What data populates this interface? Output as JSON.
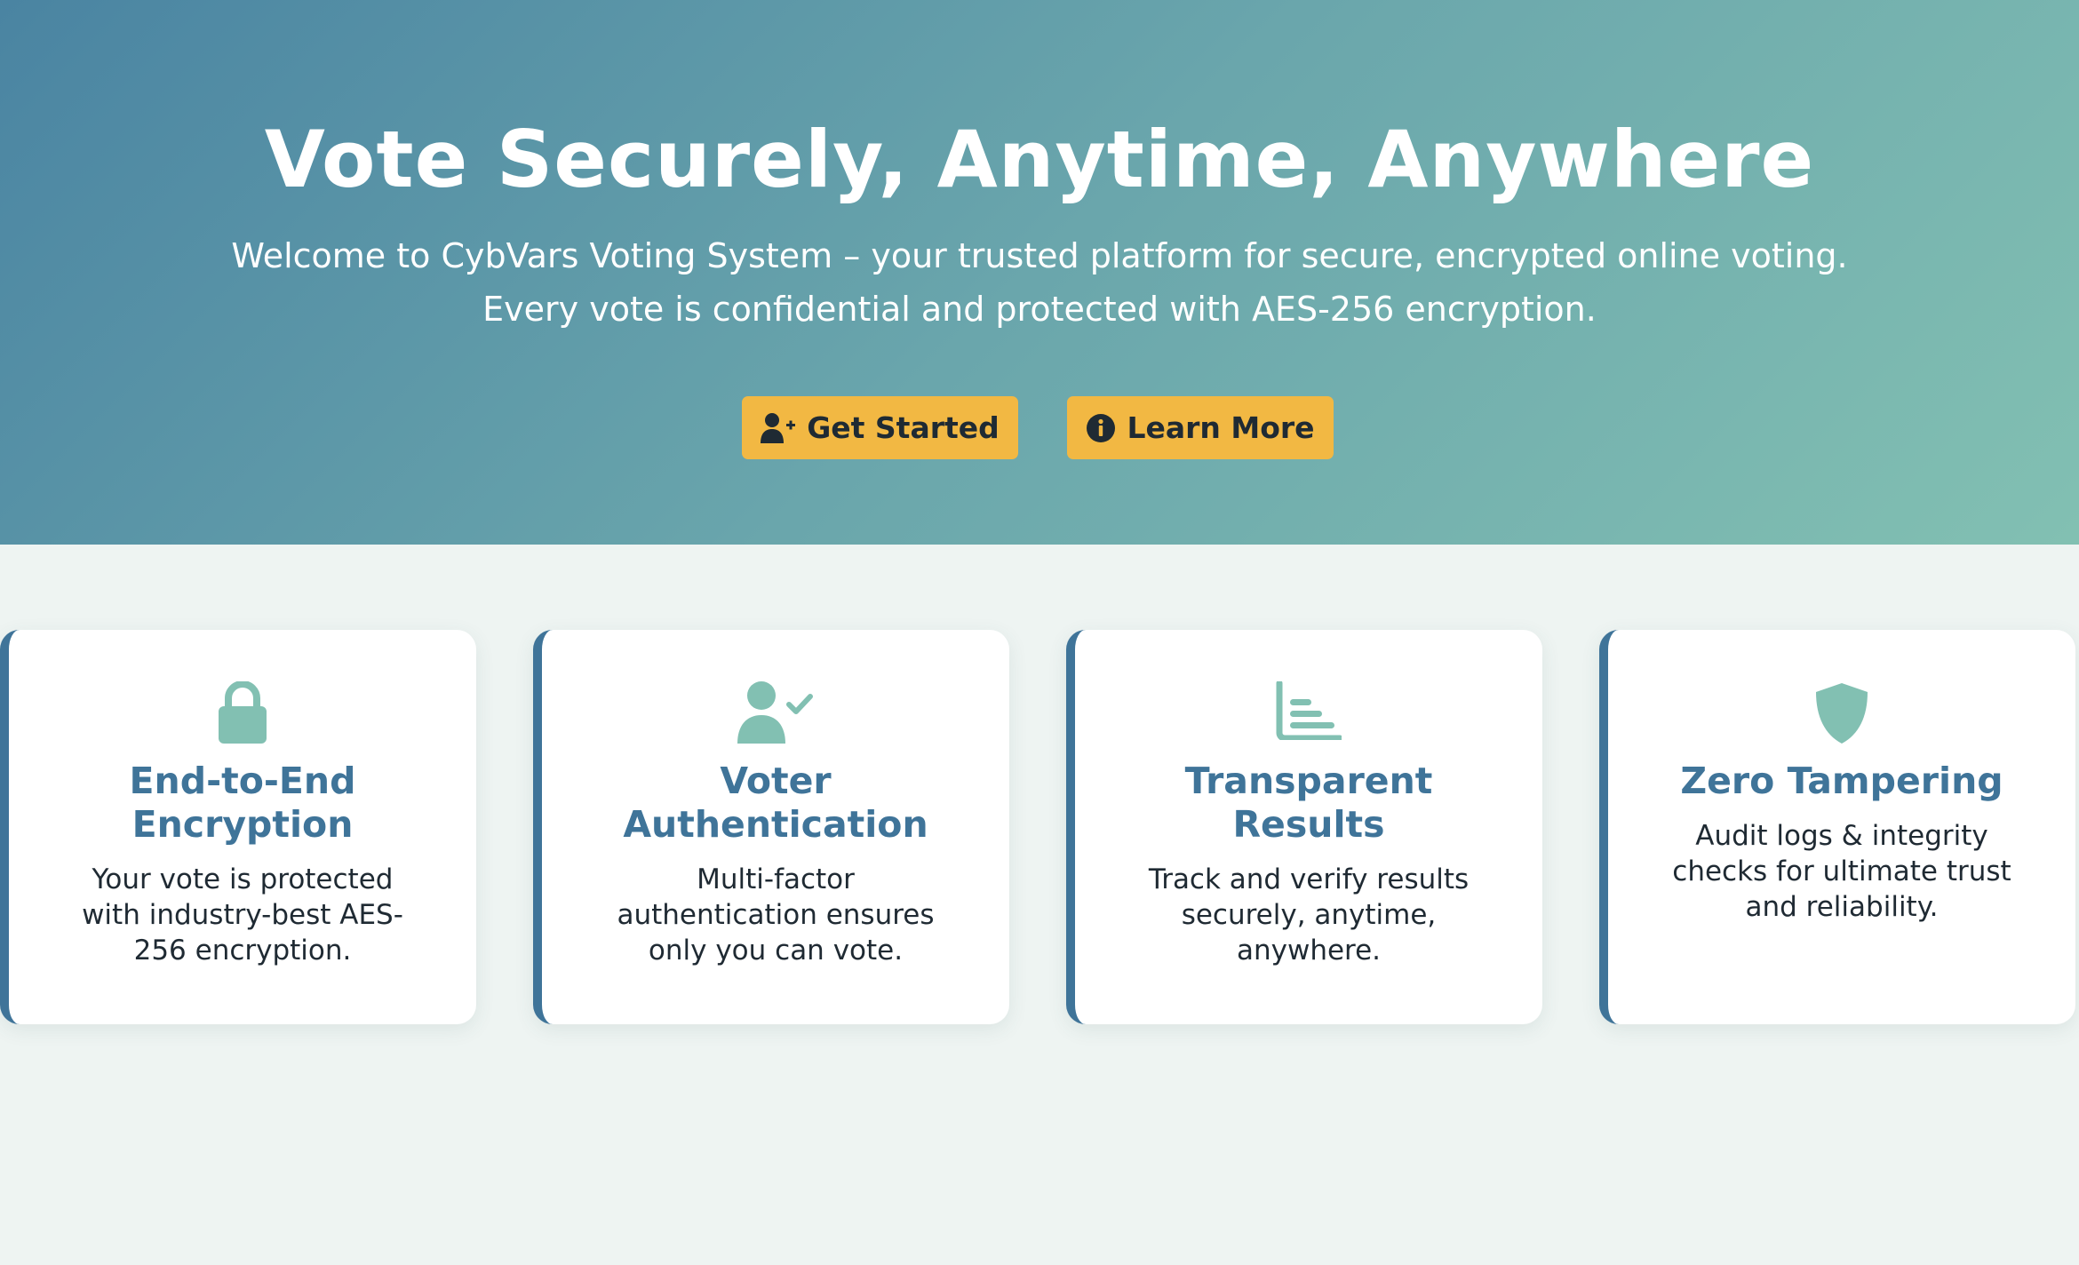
{
  "hero": {
    "title": "Vote Securely, Anytime, Anywhere",
    "subtitle_line1": "Welcome to CybVars Voting System – your trusted platform for secure, encrypted online voting.",
    "subtitle_line2": "Every vote is confidential and protected with AES-256 encryption.",
    "buttons": [
      {
        "label": "Get Started",
        "icon": "user-plus-icon"
      },
      {
        "label": "Learn More",
        "icon": "info-circle-icon"
      }
    ]
  },
  "features": [
    {
      "icon": "lock-icon",
      "title": "End-to-End Encryption",
      "description": "Your vote is protected with industry-best AES-256 encryption."
    },
    {
      "icon": "user-check-icon",
      "title": "Voter Authentication",
      "description": "Multi-factor authentication ensures only you can vote."
    },
    {
      "icon": "bar-chart-icon",
      "title": "Transparent Results",
      "description": "Track and verify results securely, anytime, anywhere."
    },
    {
      "icon": "shield-icon",
      "title": "Zero Tampering",
      "description": "Audit logs & integrity checks for ultimate trust and reliability."
    }
  ],
  "colors": {
    "accent": "#3f7499",
    "button": "#f2b843",
    "icon": "#82c0b2",
    "hero_start": "#4a84a2",
    "hero_end": "#82c0b2",
    "background": "#eef4f2"
  }
}
